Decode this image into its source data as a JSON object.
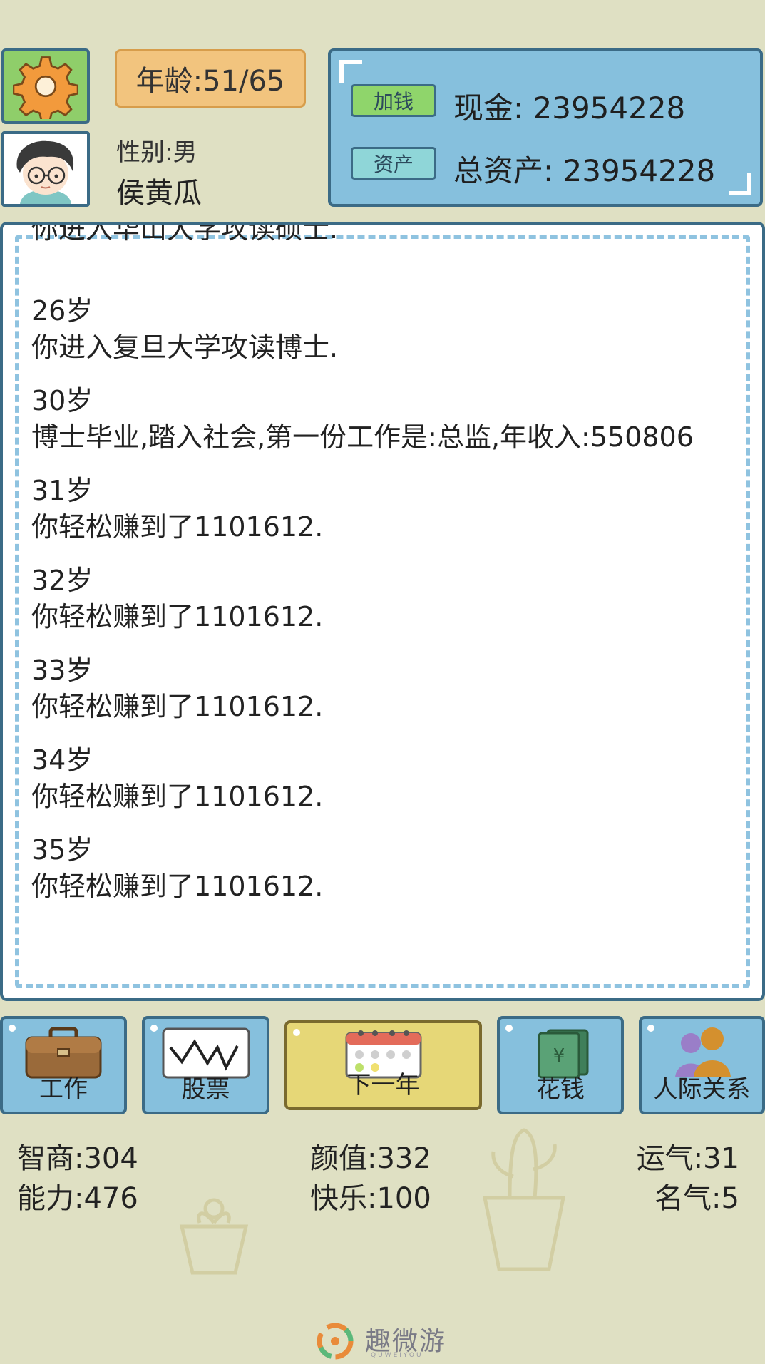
{
  "header": {
    "settings_icon": "gear-icon",
    "avatar_icon": "boy-with-glasses-avatar",
    "age": "年龄:51/65",
    "gender": "性别:男",
    "name": "侯黄瓜"
  },
  "money": {
    "add_money_button": "加钱",
    "cash": "现金: 23954228",
    "assets_button": "资产",
    "total_assets": "总资产: 23954228"
  },
  "log": {
    "partial_top": "你进入华山大学攻读硕士.",
    "entries": [
      {
        "age": "26岁",
        "text": "你进入复旦大学攻读博士."
      },
      {
        "age": "30岁",
        "text": "博士毕业,踏入社会,第一份工作是:总监,年收入:550806"
      },
      {
        "age": "31岁",
        "text": "你轻松赚到了1101612."
      },
      {
        "age": "32岁",
        "text": "你轻松赚到了1101612."
      },
      {
        "age": "33岁",
        "text": "你轻松赚到了1101612."
      },
      {
        "age": "34岁",
        "text": "你轻松赚到了1101612."
      },
      {
        "age": "35岁",
        "text": "你轻松赚到了1101612."
      }
    ]
  },
  "actions": {
    "work": "工作",
    "stocks": "股票",
    "next_year": "下一年",
    "spend": "花钱",
    "relations": "人际关系"
  },
  "stats": {
    "iq": "智商:304",
    "looks": "颜值:332",
    "luck": "运气:31",
    "ability": "能力:476",
    "happiness": "快乐:100",
    "fame": "名气:5"
  },
  "watermark": {
    "text": "趣微游",
    "sub": "QUWEIYOU"
  },
  "colors": {
    "background": "#dfe0c3",
    "panel_blue": "#86c0dd",
    "border_blue": "#3b6b86",
    "dash_blue": "#8fc3e0",
    "age_orange": "#f2c47e",
    "green": "#8fce6a",
    "next_year_yellow": "#e6d777"
  }
}
